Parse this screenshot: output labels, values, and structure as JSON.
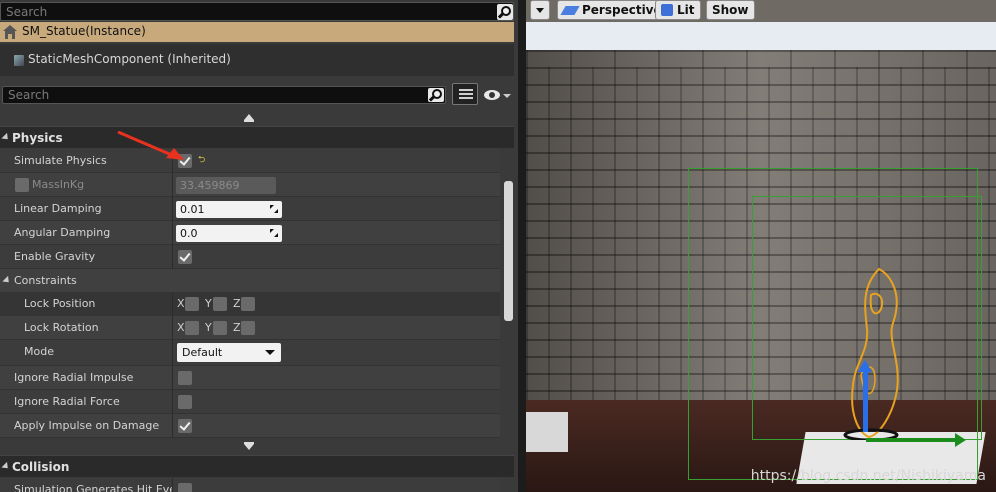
{
  "top_search": {
    "placeholder": "Search"
  },
  "instance": {
    "label": "SM_Statue(Instance)"
  },
  "component": {
    "label": "StaticMeshComponent (Inherited)"
  },
  "details_search": {
    "placeholder": "Search"
  },
  "categories": {
    "physics": "Physics",
    "collision": "Collision"
  },
  "physics": {
    "simulate_physics": {
      "label": "Simulate Physics",
      "checked": true
    },
    "mass_in_kg": {
      "label": "MassInKg",
      "value": "33.459869",
      "enabled": false
    },
    "linear_damping": {
      "label": "Linear Damping",
      "value": "0.01"
    },
    "angular_damping": {
      "label": "Angular Damping",
      "value": "0.0"
    },
    "enable_gravity": {
      "label": "Enable Gravity",
      "checked": true
    },
    "constraints": {
      "label": "Constraints"
    },
    "lock_position": {
      "label": "Lock Position",
      "x": "X",
      "y": "Y",
      "z": "Z"
    },
    "lock_rotation": {
      "label": "Lock Rotation",
      "x": "X",
      "y": "Y",
      "z": "Z"
    },
    "mode": {
      "label": "Mode",
      "value": "Default"
    },
    "ignore_radial_impulse": {
      "label": "Ignore Radial Impulse",
      "checked": false
    },
    "ignore_radial_force": {
      "label": "Ignore Radial Force",
      "checked": false
    },
    "apply_impulse_on_damage": {
      "label": "Apply Impulse on Damage",
      "checked": true
    }
  },
  "collision": {
    "sim_gen_hit_events": {
      "label": "Simulation Generates Hit Events"
    }
  },
  "viewport": {
    "perspective_label": "Perspective",
    "lit_label": "Lit",
    "show_label": "Show"
  },
  "watermark": "https://blog.csdn.net/Nishikiyama",
  "colors": {
    "instance_row": "#c8a97c",
    "bounds": "#37a030",
    "statue_outline": "#e8a21f",
    "gizmo_z": "#2a6ee8",
    "gizmo_x": "#1c8d1c",
    "annotation_arrow": "#e8321e"
  }
}
